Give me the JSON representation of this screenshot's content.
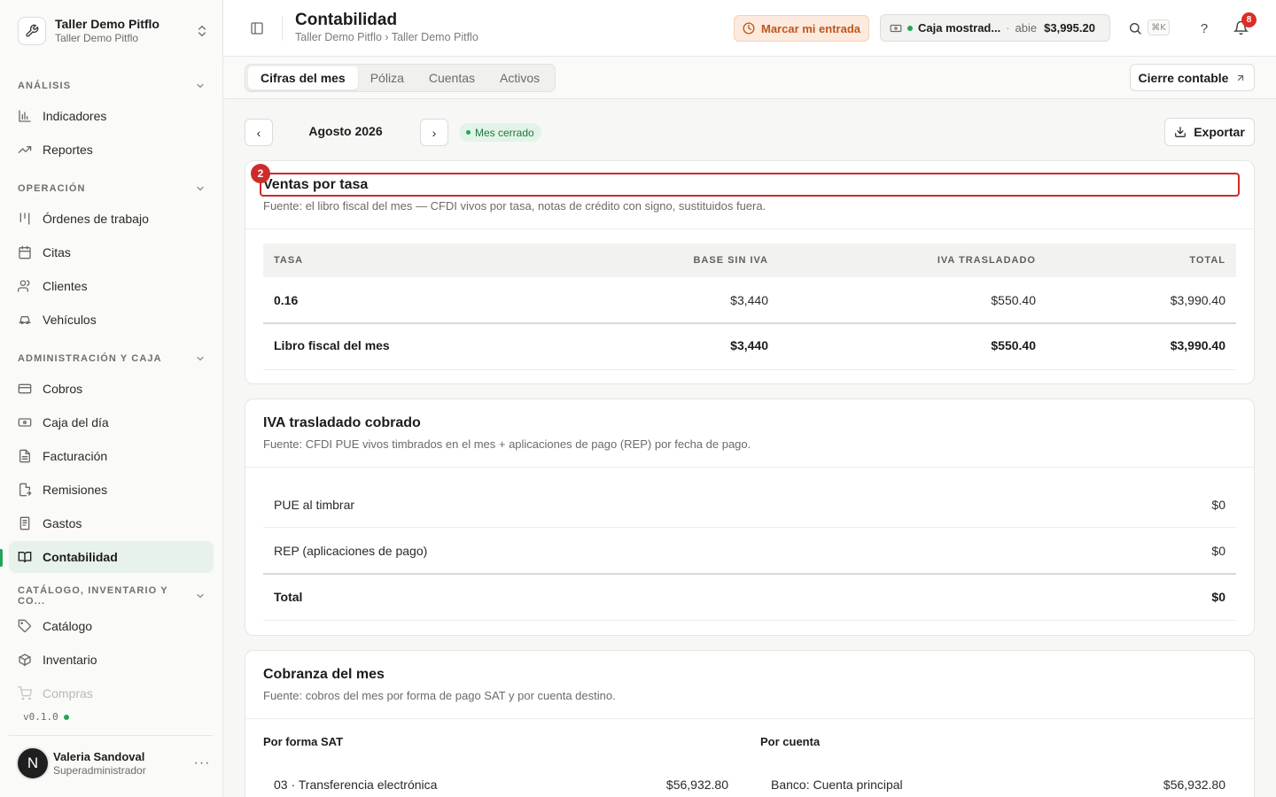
{
  "workspace": {
    "name": "Taller Demo Pitflo",
    "subtitle": "Taller Demo Pitflo"
  },
  "sidebar": {
    "sections": [
      {
        "label": "ANÁLISIS",
        "items": [
          {
            "label": "Indicadores",
            "icon": "bar-chart-icon"
          },
          {
            "label": "Reportes",
            "icon": "trending-up-icon"
          }
        ]
      },
      {
        "label": "OPERACIÓN",
        "items": [
          {
            "label": "Órdenes de trabajo",
            "icon": "kanban-icon"
          },
          {
            "label": "Citas",
            "icon": "calendar-icon"
          },
          {
            "label": "Clientes",
            "icon": "users-icon"
          },
          {
            "label": "Vehículos",
            "icon": "car-icon"
          }
        ]
      },
      {
        "label": "ADMINISTRACIÓN Y CAJA",
        "items": [
          {
            "label": "Cobros",
            "icon": "credit-card-icon"
          },
          {
            "label": "Caja del día",
            "icon": "banknote-icon"
          },
          {
            "label": "Facturación",
            "icon": "file-text-icon"
          },
          {
            "label": "Remisiones",
            "icon": "file-export-icon"
          },
          {
            "label": "Gastos",
            "icon": "receipt-icon"
          },
          {
            "label": "Contabilidad",
            "icon": "book-open-icon"
          }
        ]
      },
      {
        "label": "CATÁLOGO, INVENTARIO Y CO...",
        "items": [
          {
            "label": "Catálogo",
            "icon": "tags-icon"
          },
          {
            "label": "Inventario",
            "icon": "box-icon"
          },
          {
            "label": "Compras",
            "icon": "cart-icon"
          }
        ]
      }
    ],
    "version": "v0.1.0",
    "user": {
      "initial": "N",
      "name": "Valeria Sandoval",
      "role": "Superadministrador",
      "more": "···"
    }
  },
  "header": {
    "title": "Contabilidad",
    "breadcrumb": "Taller Demo Pitflo › Taller Demo Pitflo",
    "clock_in_label": "Marcar mi entrada",
    "cash_register": {
      "name": "Caja mostrad...",
      "separator": "·",
      "status": "abie",
      "amount": "$3,995.20"
    },
    "search_shortcut": "⌘K",
    "help": "?",
    "notifications_count": "8"
  },
  "tabs": [
    "Cifras del mes",
    "Póliza",
    "Cuentas",
    "Activos"
  ],
  "close_button": "Cierre contable",
  "period": {
    "prev": "‹",
    "next": "›",
    "label": "Agosto 2026",
    "status": "Mes cerrado",
    "export_label": "Exportar"
  },
  "highlight": {
    "number": "2"
  },
  "ventas": {
    "title": "Ventas por tasa",
    "subtitle": "Fuente: el libro fiscal del mes — CFDI vivos por tasa, notas de crédito con signo, sustituidos fuera.",
    "columns": [
      "TASA",
      "BASE SIN IVA",
      "IVA TRASLADADO",
      "TOTAL"
    ],
    "rows": [
      {
        "tasa": "0.16",
        "base": "$3,440",
        "iva": "$550.40",
        "total": "$3,990.40"
      }
    ],
    "total_row": {
      "label": "Libro fiscal del mes",
      "base": "$3,440",
      "iva": "$550.40",
      "total": "$3,990.40"
    }
  },
  "iva": {
    "title": "IVA trasladado cobrado",
    "subtitle": "Fuente: CFDI PUE vivos timbrados en el mes + aplicaciones de pago (REP) por fecha de pago.",
    "rows": [
      {
        "label": "PUE al timbrar",
        "value": "$0"
      },
      {
        "label": "REP (aplicaciones de pago)",
        "value": "$0"
      }
    ],
    "total": {
      "label": "Total",
      "value": "$0"
    }
  },
  "cobranza": {
    "title": "Cobranza del mes",
    "subtitle": "Fuente: cobros del mes por forma de pago SAT y por cuenta destino.",
    "by_form_title": "Por forma SAT",
    "by_account_title": "Por cuenta",
    "by_form": [
      {
        "label": "03 · Transferencia electrónica",
        "value": "$56,932.80"
      }
    ],
    "by_account": [
      {
        "label": "Banco: Cuenta principal",
        "value": "$56,932.80"
      }
    ]
  },
  "colors": {
    "accent_green": "#22a55a",
    "warning_orange": "#c0571b",
    "highlight_red": "#cf2b2b"
  }
}
